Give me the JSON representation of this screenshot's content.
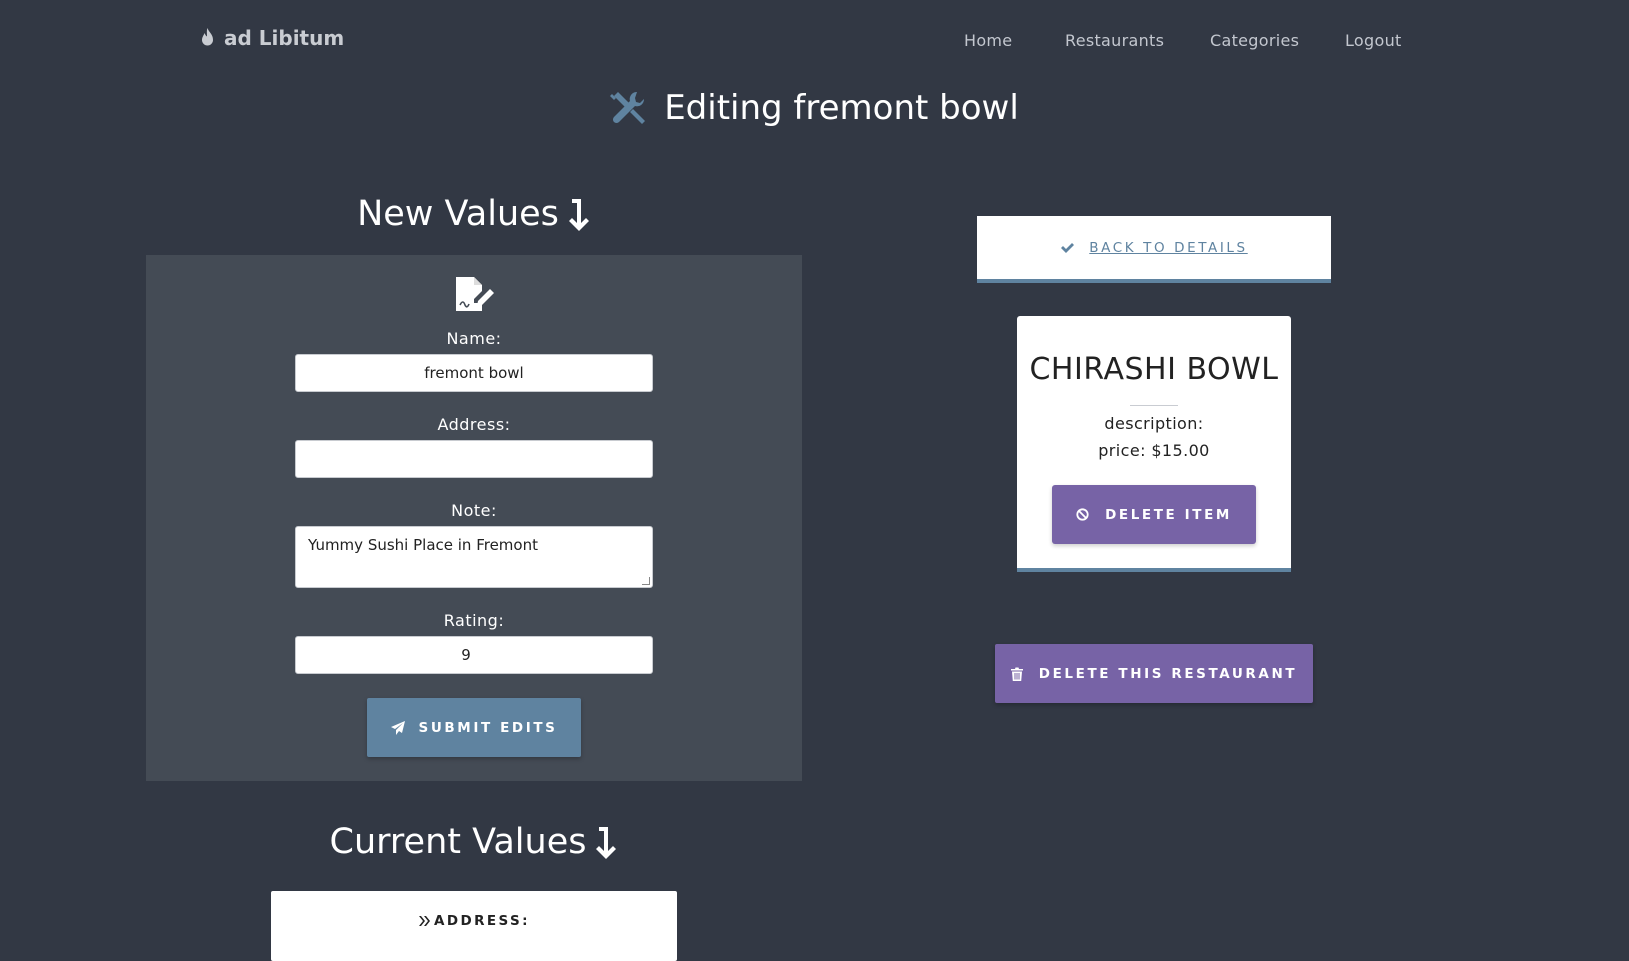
{
  "nav": {
    "brand": "ad Libitum",
    "brand_icon": "fire-icon",
    "links": [
      "Home",
      "Restaurants",
      "Categories",
      "Logout"
    ]
  },
  "page": {
    "title": "Editing fremont bowl",
    "title_icon": "tools-icon"
  },
  "form": {
    "heading": "New Values",
    "heading_icon": "arrow-down-icon",
    "form_icon": "file-signature-icon",
    "name_label": "Name:",
    "name_value": "fremont bowl",
    "address_label": "Address:",
    "address_value": "",
    "note_label": "Note:",
    "note_value": "Yummy Sushi Place in Fremont",
    "rating_label": "Rating:",
    "rating_value": "9",
    "submit_label": "SUBMIT EDITS",
    "submit_icon": "paper-plane-icon"
  },
  "current": {
    "heading": "Current Values",
    "heading_icon": "arrow-down-icon",
    "address_label": "ADDRESS:",
    "address_icon": "double-chevron-right-icon"
  },
  "back": {
    "label": "BACK TO DETAILS",
    "icon": "check-icon"
  },
  "item": {
    "title": "CHIRASHI BOWL",
    "description": "description:",
    "price": "price: $15.00",
    "delete_label": "DELETE ITEM",
    "delete_icon": "ban-icon"
  },
  "restaurant": {
    "delete_label": "DELETE THIS RESTAURANT",
    "delete_icon": "trash-icon"
  },
  "colors": {
    "background": "#323844",
    "panel": "#444b55",
    "accent_blue": "#5f83a0",
    "accent_purple": "#7763a6"
  }
}
